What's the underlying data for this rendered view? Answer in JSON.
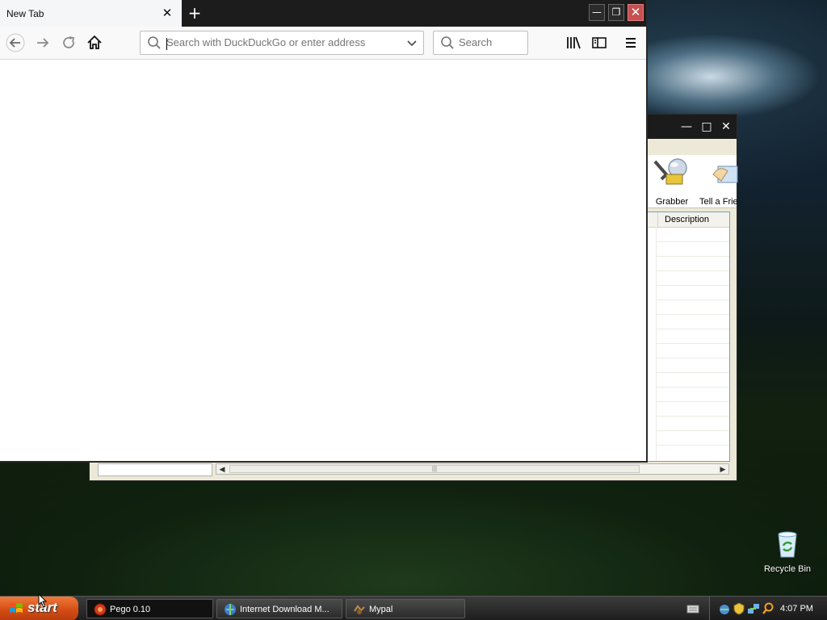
{
  "browser": {
    "tab": {
      "title": "New Tab"
    },
    "urlbar": {
      "placeholder": "Search with DuckDuckGo or enter address",
      "value": ""
    },
    "searchbox": {
      "placeholder": "Search",
      "value": ""
    }
  },
  "idm": {
    "toolbar": [
      {
        "label": "Grabber",
        "icon": "grabber-icon"
      },
      {
        "label": "Tell a Frie",
        "icon": "tell-a-friend-icon"
      }
    ],
    "list": {
      "column_description": "Description"
    }
  },
  "desktop": {
    "icons": [
      {
        "label": "Recycle Bin",
        "icon": "recycle-bin-icon"
      }
    ]
  },
  "taskbar": {
    "start_label": "start",
    "tasks": [
      {
        "label": "Pego 0.10",
        "icon": "pego-icon",
        "active": true
      },
      {
        "label": "Internet Download M...",
        "icon": "idm-icon",
        "active": false
      },
      {
        "label": "Mypal",
        "icon": "mypal-icon",
        "active": false
      }
    ],
    "clock": "4:07 PM"
  },
  "colors": {
    "start_button": "#d44d15",
    "close_button": "#c75050",
    "taskbar": "#1e1e1e"
  }
}
